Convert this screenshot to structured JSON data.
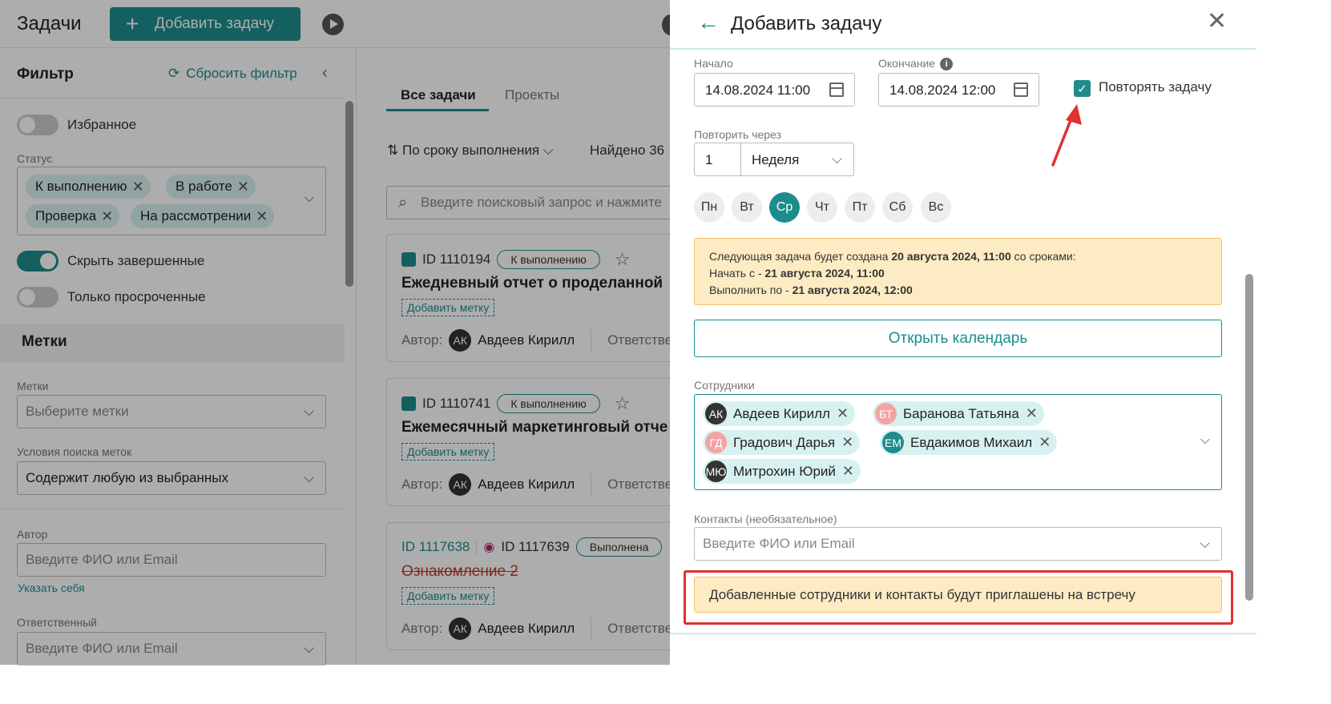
{
  "header": {
    "app_title": "Задачи",
    "add_task_label": "Добавить задачу"
  },
  "sidebar": {
    "title": "Фильтр",
    "reset_label": "Сбросить фильтр",
    "favorites_label": "Избранное",
    "status_label": "Статус",
    "status_chips": [
      "К выполнению",
      "В работе",
      "Проверка",
      "На рассмотрении"
    ],
    "hide_completed_label": "Скрыть завершенные",
    "overdue_only_label": "Только просроченные",
    "tags_section": "Метки",
    "tags_label": "Метки",
    "tags_placeholder": "Выберите метки",
    "tag_search_label": "Условия поиска меток",
    "tag_search_value": "Содержит любую из выбранных",
    "author_label": "Автор",
    "author_placeholder": "Введите ФИО или Email",
    "set_self_link": "Указать себя",
    "responsible_label": "Ответственный",
    "responsible_placeholder": "Введите ФИО или Email"
  },
  "main": {
    "tabs": [
      "Все задачи",
      "Проекты"
    ],
    "sort_label": "По сроку выполнения",
    "found_label": "Найдено 36",
    "search_placeholder": "Введите поисковый запрос и нажмите",
    "cards": [
      {
        "id": "ID 1110194",
        "status": "К выполнению",
        "title": "Ежедневный отчет о проделанной",
        "tag_button": "Добавить метку",
        "author_prefix": "Автор:",
        "author_initials": "АК",
        "author_name": "Авдеев Кирилл",
        "responsible_prefix": "Ответстве"
      },
      {
        "id": "ID 1110741",
        "status": "К выполнению",
        "title": "Ежемесячный маркетинговый отче",
        "tag_button": "Добавить метку",
        "author_prefix": "Автор:",
        "author_initials": "АК",
        "author_name": "Авдеев Кирилл",
        "responsible_prefix": "Ответстве"
      },
      {
        "id_link": "ID 1117638",
        "id": "ID 1117639",
        "status": "Выполнена",
        "title": "Ознакомление 2",
        "tag_button": "Добавить метку",
        "author_prefix": "Автор:",
        "author_initials": "АК",
        "author_name": "Авдеев Кирилл",
        "responsible_prefix": "Ответстве"
      }
    ]
  },
  "panel": {
    "title": "Добавить задачу",
    "start_label": "Начало",
    "start_value": "14.08.2024 11:00",
    "end_label": "Окончание",
    "end_value": "14.08.2024 12:00",
    "repeat_label": "Повторять задачу",
    "repeat_every_label": "Повторить через",
    "repeat_every_value": "1",
    "repeat_unit": "Неделя",
    "days": [
      "Пн",
      "Вт",
      "Ср",
      "Чт",
      "Пт",
      "Сб",
      "Вс"
    ],
    "active_day": "Ср",
    "notice": {
      "line1_prefix": "Следующая задача будет создана ",
      "line1_bold": "20 августа 2024, 11:00",
      "line1_suffix": " со сроками:",
      "line2_prefix": "Начать с - ",
      "line2_bold": "21 августа 2024, 11:00",
      "line3_prefix": "Выполнить по - ",
      "line3_bold": "21 августа 2024, 12:00"
    },
    "open_calendar_label": "Открыть календарь",
    "employees_label": "Сотрудники",
    "employees": [
      {
        "initials": "АК",
        "name": "Авдеев Кирилл",
        "color": "#333333"
      },
      {
        "initials": "БТ",
        "name": "Баранова Татьяна",
        "color": "#f4a3a3"
      },
      {
        "initials": "ГД",
        "name": "Градович Дарья",
        "color": "#f4a3a3"
      },
      {
        "initials": "ЕМ",
        "name": "Евдакимов Михаил",
        "color": "#1e8c8c"
      },
      {
        "initials": "МЮ",
        "name": "Митрохин Юрий",
        "color": "#333333"
      }
    ],
    "contacts_label": "Контакты (необязательное)",
    "contacts_placeholder": "Введите ФИО или Email",
    "invite_notice": "Добавленные сотрудники и контакты будут приглашены на встречу"
  },
  "colors": {
    "accent": "#1e8c8c",
    "notice_bg": "#fdebc3",
    "highlight": "#e03131"
  }
}
